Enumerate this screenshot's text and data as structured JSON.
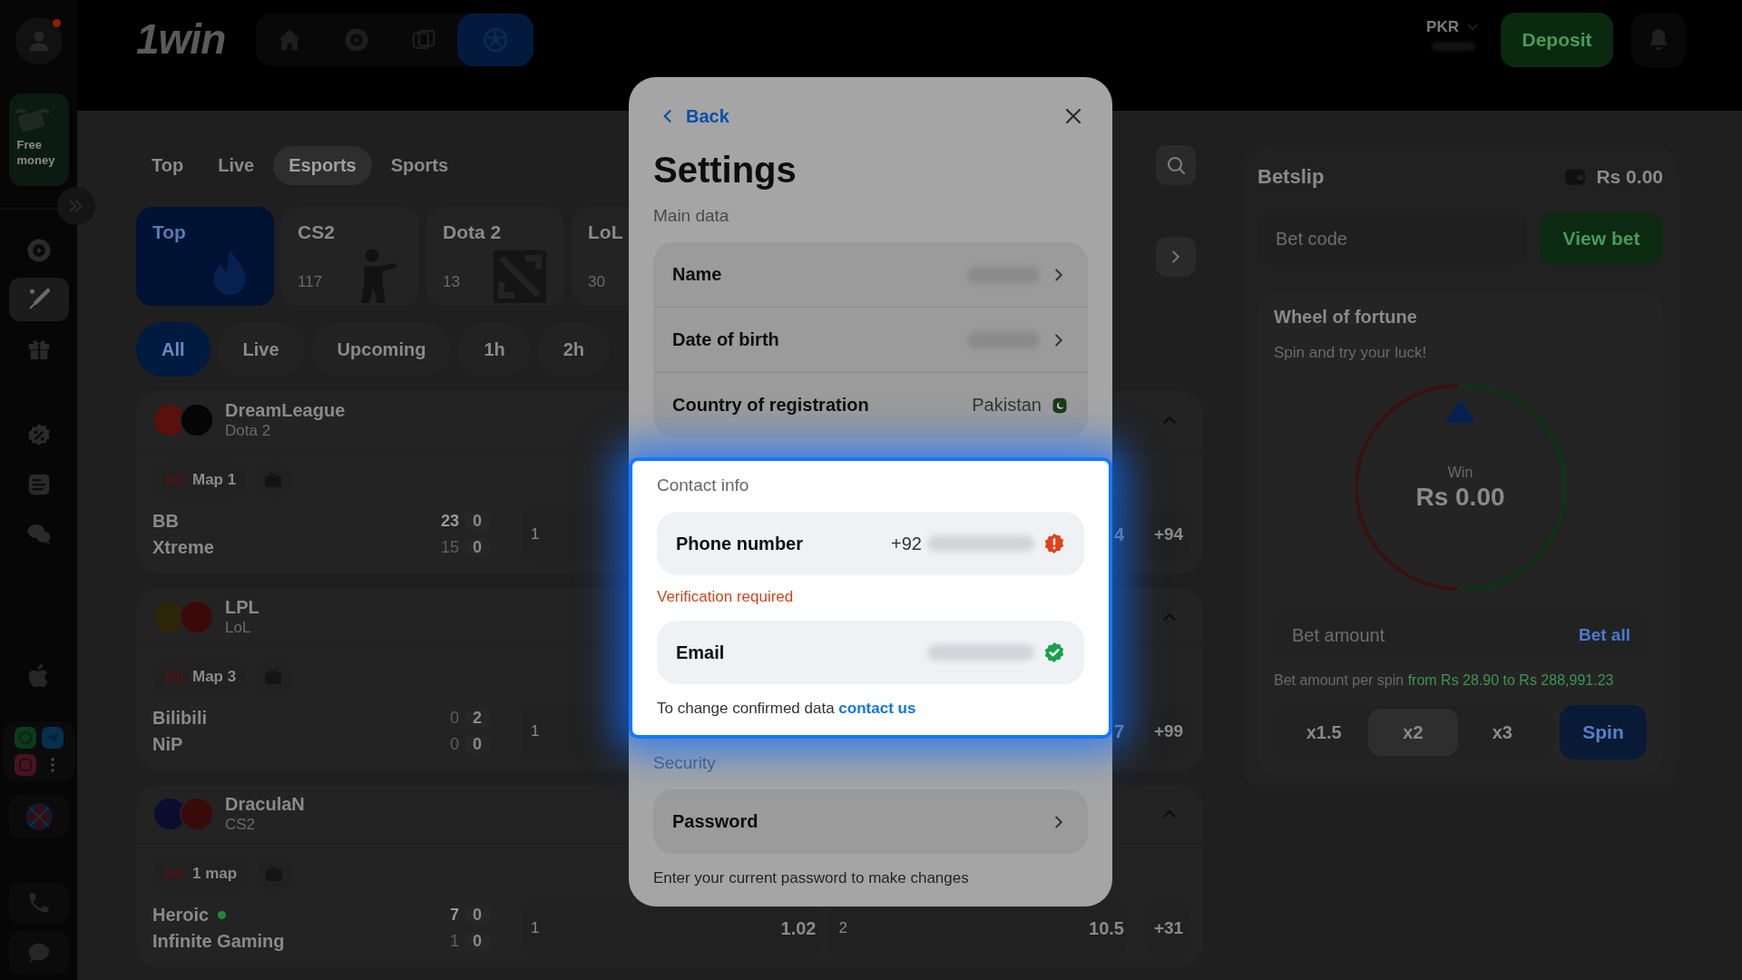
{
  "sidebar": {
    "alert": true,
    "promo": "Free money",
    "items": [
      {
        "kind": "chip",
        "selected": false
      },
      {
        "kind": "bat",
        "selected": true
      },
      {
        "kind": "gift",
        "selected": false
      },
      {
        "kind": "percent",
        "selected": false
      },
      {
        "kind": "document",
        "selected": false
      },
      {
        "kind": "chat",
        "selected": false
      }
    ]
  },
  "header": {
    "logo": "1win",
    "nav": [
      {
        "kind": "home",
        "selected": false
      },
      {
        "kind": "chip",
        "selected": false
      },
      {
        "kind": "cards",
        "selected": false
      },
      {
        "kind": "ball",
        "selected": true
      }
    ],
    "currency": "PKR",
    "balance_masked": true,
    "deposit": "Deposit"
  },
  "tabs": [
    {
      "label": "Top",
      "selected": false
    },
    {
      "label": "Live",
      "selected": false
    },
    {
      "label": "Esports",
      "selected": true
    },
    {
      "label": "Sports",
      "selected": false
    }
  ],
  "categories": [
    {
      "label": "Top",
      "kind": "fire",
      "selected": true
    },
    {
      "label": "CS2",
      "count": "117",
      "kind": "soldier",
      "selected": false
    },
    {
      "label": "Dota 2",
      "count": "13",
      "kind": "dota",
      "selected": false
    },
    {
      "label": "LoL",
      "count": "30",
      "kind": "plain",
      "selected": false
    }
  ],
  "filters": [
    {
      "label": "All",
      "selected": true
    },
    {
      "label": "Live",
      "selected": false
    },
    {
      "label": "Upcoming",
      "selected": false
    },
    {
      "label": "1h",
      "selected": false
    },
    {
      "label": "2h",
      "selected": false
    }
  ],
  "leagues": [
    {
      "name": "DreamLeague",
      "game": "Dota 2",
      "logos": [
        {
          "color": "#5a100c"
        },
        {
          "color": "#050505"
        }
      ],
      "expanded": true,
      "status": "Map 1",
      "teams": [
        {
          "name": "BB",
          "score": "23",
          "maps": "0",
          "leading": true,
          "online": false
        },
        {
          "name": "Xtreme",
          "score": "15",
          "maps": "0",
          "leading": false,
          "online": false
        }
      ],
      "outcomes": [
        {
          "label": "1"
        },
        {
          "value": "4"
        }
      ],
      "more": "+94"
    },
    {
      "name": "LPL",
      "game": "LoL",
      "logos": [
        {
          "color": "#2e2608"
        },
        {
          "color": "#3a0a0a"
        }
      ],
      "expanded": true,
      "status": "Map 3",
      "teams": [
        {
          "name": "Bilibili",
          "score": "0",
          "maps": "2",
          "leading": false,
          "online": false
        },
        {
          "name": "NiP",
          "score": "0",
          "maps": "0",
          "leading": false,
          "online": false
        }
      ],
      "outcomes": [
        {
          "label": "1"
        },
        {
          "value": "7"
        }
      ],
      "more": "+99"
    },
    {
      "name": "DraculaN",
      "game": "CS2",
      "logos": [
        {
          "color": "#0a0d2e"
        },
        {
          "color": "#3a0a0a"
        }
      ],
      "expanded": true,
      "status": "1 map",
      "teams": [
        {
          "name": "Heroic",
          "score": "7",
          "maps": "0",
          "leading": true,
          "online": true
        },
        {
          "name": "Infinite Gaming",
          "score": "1",
          "maps": "0",
          "leading": false,
          "online": false
        }
      ],
      "outcomes": [
        {
          "label": "1",
          "value": "1.02"
        },
        {
          "label": "2",
          "value": "10.5"
        }
      ],
      "more": "+31"
    }
  ],
  "betslip": {
    "title": "Betslip",
    "balance": "Rs 0.00",
    "code_placeholder": "Bet code",
    "view_button": "View bet",
    "wheel": {
      "title": "Wheel of fortune",
      "subtitle": "Spin and try your luck!",
      "win_label": "Win",
      "win_amount": "Rs 0.00",
      "amount_placeholder": "Bet amount",
      "bet_all": "Bet all",
      "range_label": "Bet amount per spin",
      "range": "from Rs 28.90 to Rs 288,991.23",
      "multipliers": [
        {
          "label": "x1.5",
          "selected": false
        },
        {
          "label": "x2",
          "selected": true
        },
        {
          "label": "x3",
          "selected": false
        }
      ],
      "spin": "Spin"
    }
  },
  "settings": {
    "back": "Back",
    "title": "Settings",
    "sections": [
      {
        "title": "Main data",
        "highlighted": false,
        "grouped": true,
        "rows": [
          {
            "label": "Name",
            "masked": true,
            "kind": "chevron"
          },
          {
            "label": "Date of birth",
            "masked": true,
            "kind": "chevron"
          },
          {
            "label": "Country of registration",
            "value": "Pakistan",
            "masked": false,
            "kind": "flag"
          }
        ]
      },
      {
        "title": "Contact info",
        "highlighted": true,
        "grouped": false,
        "rows": [
          {
            "label": "Phone number",
            "value": "+92",
            "masked": true,
            "kind": "warning",
            "note": "Verification required"
          },
          {
            "label": "Email",
            "masked": true,
            "kind": "verified"
          }
        ],
        "footer": "To change confirmed data",
        "link": "contact us"
      },
      {
        "title": "Security",
        "highlighted": false,
        "grouped": true,
        "rows": [
          {
            "label": "Password",
            "masked": false,
            "kind": "chevron"
          }
        ],
        "footer": "Enter your current password to make changes"
      }
    ]
  }
}
